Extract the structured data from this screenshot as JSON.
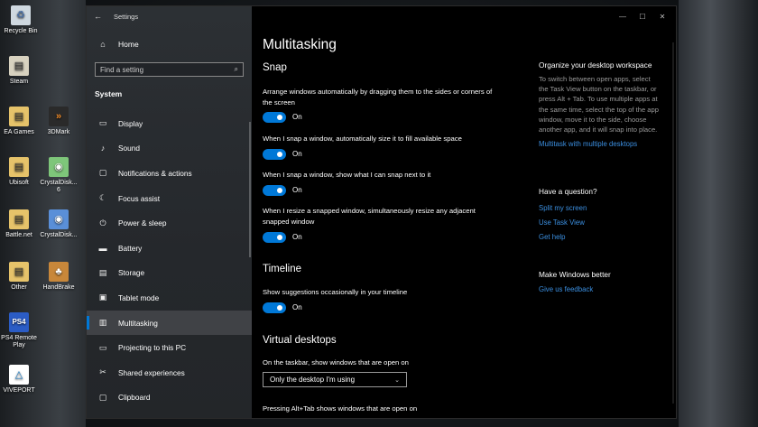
{
  "desktop_icons": [
    {
      "label": "Recycle Bin",
      "icon": "recycle-bin-icon"
    },
    {
      "label": "Steam",
      "icon": "steam-icon"
    },
    {
      "label": "EA Games",
      "icon": "folder-icon"
    },
    {
      "label": "3DMark",
      "icon": "3dmark-icon"
    },
    {
      "label": "Ubisoft",
      "icon": "folder-icon"
    },
    {
      "label": "CrystalDisk... 6",
      "icon": "crystaldisk-icon"
    },
    {
      "label": "Battle.net",
      "icon": "folder-icon"
    },
    {
      "label": "CrystalDisk...",
      "icon": "crystaldisk-icon"
    },
    {
      "label": "Other",
      "icon": "folder-icon"
    },
    {
      "label": "HandBrake",
      "icon": "handbrake-icon"
    },
    {
      "label": "PS4 Remote Play",
      "icon": "ps4-icon"
    },
    {
      "label": "VIVEPORT",
      "icon": "viveport-icon"
    }
  ],
  "window": {
    "title": "Settings",
    "back": "←",
    "controls": {
      "minimize": "—",
      "maximize": "☐",
      "close": "✕"
    }
  },
  "nav": {
    "home": "Home",
    "home_icon": "⌂",
    "search_placeholder": "Find a setting",
    "search_icon": "⌕",
    "section": "System",
    "items": [
      {
        "label": "Display",
        "icon": "▭"
      },
      {
        "label": "Sound",
        "icon": "♪"
      },
      {
        "label": "Notifications & actions",
        "icon": "▢"
      },
      {
        "label": "Focus assist",
        "icon": "☾"
      },
      {
        "label": "Power & sleep",
        "icon": "⏻"
      },
      {
        "label": "Battery",
        "icon": "▬"
      },
      {
        "label": "Storage",
        "icon": "▤"
      },
      {
        "label": "Tablet mode",
        "icon": "▣"
      },
      {
        "label": "Multitasking",
        "icon": "▥"
      },
      {
        "label": "Projecting to this PC",
        "icon": "▭"
      },
      {
        "label": "Shared experiences",
        "icon": "✂"
      },
      {
        "label": "Clipboard",
        "icon": "▢"
      }
    ],
    "active_index": 8
  },
  "main": {
    "title": "Multitasking",
    "snap": {
      "heading": "Snap",
      "settings": [
        {
          "text": "Arrange windows automatically by dragging them to the sides or corners of the screen",
          "state": "On"
        },
        {
          "text": "When I snap a window, automatically size it to fill available space",
          "state": "On"
        },
        {
          "text": "When I snap a window, show what I can snap next to it",
          "state": "On"
        },
        {
          "text": "When I resize a snapped window, simultaneously resize any adjacent snapped window",
          "state": "On"
        }
      ]
    },
    "timeline": {
      "heading": "Timeline",
      "settings": [
        {
          "text": "Show suggestions occasionally in your timeline",
          "state": "On"
        }
      ]
    },
    "virtual_desktops": {
      "heading": "Virtual desktops",
      "taskbar_label": "On the taskbar, show windows that are open on",
      "taskbar_value": "Only the desktop I'm using",
      "alttab_label": "Pressing Alt+Tab shows windows that are open on"
    }
  },
  "sidebar": {
    "organize_heading": "Organize your desktop workspace",
    "organize_text": "To switch between open apps, select the Task View button on the taskbar, or press Alt + Tab. To use multiple apps at the same time, select the top of the app window, move it to the side, choose another app, and it will snap into place.",
    "organize_link": "Multitask with multiple desktops",
    "question_heading": "Have a question?",
    "question_links": [
      "Split my screen",
      "Use Task View",
      "Get help"
    ],
    "better_heading": "Make Windows better",
    "feedback_link": "Give us feedback"
  },
  "colors": {
    "accent": "#0078d7",
    "link": "#3b8fe0"
  }
}
